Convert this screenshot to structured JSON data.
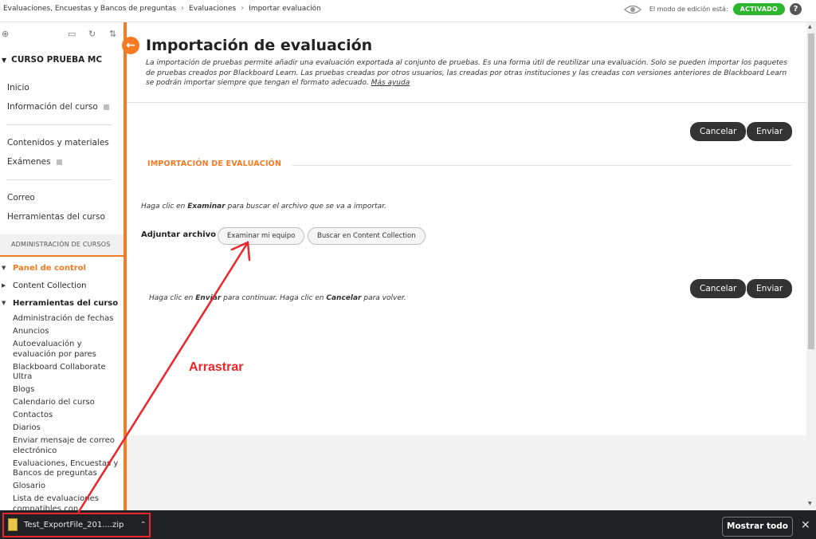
{
  "breadcrumb": [
    "Evaluaciones, Encuestas y Bancos de preguntas",
    "Evaluaciones",
    "Importar evaluación"
  ],
  "edit_mode": {
    "label": "El modo de edición está:",
    "state": "ACTIVADO",
    "help": "?"
  },
  "sidebar": {
    "course_title": "CURSO PRUEBA MC",
    "group1": [
      "Inicio",
      "Información del curso"
    ],
    "group2": [
      "Contenidos y materiales",
      "Exámenes"
    ],
    "group3": [
      "Correo",
      "Herramientas del curso"
    ],
    "admin_header": "ADMINISTRACIÓN DE CURSOS",
    "panel_control": "Panel de control",
    "content_collection": "Content Collection",
    "course_tools": "Herramientas del curso",
    "tool_items": [
      "Administración de fechas",
      "Anuncios",
      "Autoevaluación y evaluación por pares",
      "Blackboard Collaborate Ultra",
      "Blogs",
      "Calendario del curso",
      "Contactos",
      "Diarios",
      "Enviar mensaje de correo electrónico",
      "Evaluaciones, Encuestas y Bancos de preguntas",
      "Glosario",
      "Lista de evaluaciones compatibles con dispositivos"
    ]
  },
  "main": {
    "title": "Importación de evaluación",
    "description": "La importación de pruebas permite añadir una evaluación exportada al conjunto de pruebas. Es una forma útil de reutilizar una evaluación. Solo se pueden importar los paquetes de pruebas creados por Blackboard Learn. Las pruebas creadas por otros usuarios, las creadas por otras instituciones y las creadas con versiones anteriores de Blackboard Learn se podrán importar siempre que tengan el formato adecuado.",
    "more_help": "Más ayuda",
    "cancel_label": "Cancelar",
    "send_label": "Enviar",
    "section_header": "IMPORTACIÓN DE EVALUACIÓN",
    "instruction_pre": "Haga clic en ",
    "instruction_bold": "Examinar",
    "instruction_post": " para buscar el archivo que se va a importar.",
    "attach_label": "Adjuntar archivo",
    "browse_label": "Examinar mi equipo",
    "collection_label": "Buscar en Content Collection",
    "continue_1": "Haga clic en ",
    "continue_2": "Enviar",
    "continue_3": " para continuar. Haga clic en ",
    "continue_4": "Cancelar",
    "continue_5": " para volver."
  },
  "annotation": {
    "label": "Arrastrar",
    "color": "#e8262c"
  },
  "downloads": {
    "file_name": "Test_ExportFile_201....zip",
    "show_all": "Mostrar todo",
    "close": "✕"
  },
  "colors": {
    "accent": "#f57a22",
    "active_toggle": "#2db62d",
    "dark_button": "#333333"
  }
}
